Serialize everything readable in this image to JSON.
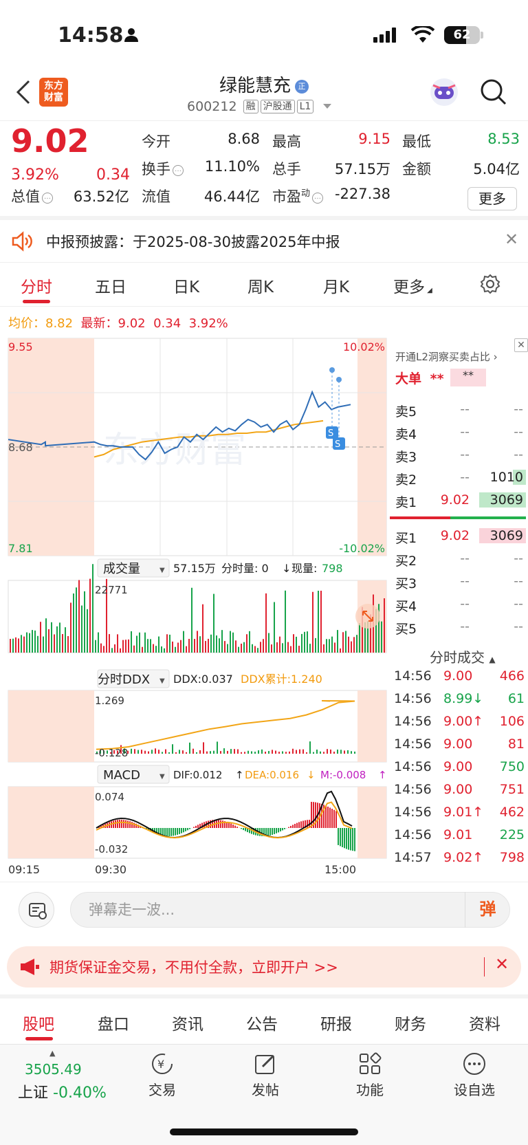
{
  "status_bar": {
    "time": "14:58",
    "battery": "62"
  },
  "header": {
    "title": "绿能慧充",
    "badge": "正",
    "code": "600212",
    "tags": [
      "融",
      "沪股通",
      "L1"
    ],
    "logo_line1": "东方",
    "logo_line2": "财富"
  },
  "quote": {
    "price": "9.02",
    "pct": "3.92%",
    "change": "0.34",
    "rows": [
      [
        {
          "label": "今开",
          "value": "8.68",
          "color": "normal"
        },
        {
          "label": "最高",
          "value": "9.15",
          "color": "red"
        },
        {
          "label": "最低",
          "value": "8.53",
          "color": "green"
        }
      ],
      [
        {
          "label": "换手",
          "value": "11.10%",
          "color": "normal"
        },
        {
          "label": "总手",
          "value": "57.15万",
          "color": "normal"
        },
        {
          "label": "金额",
          "value": "5.04亿",
          "color": "normal"
        }
      ]
    ],
    "total_value_label": "总值",
    "total_value": "63.52亿",
    "float_value_label": "流值",
    "float_value": "46.44亿",
    "pe_label": "市盈",
    "pe_sup": "动",
    "pe_value": "-227.38",
    "more": "更多"
  },
  "notice": {
    "text": "中报预披露：于2025-08-30披露2025年中报"
  },
  "chart_tabs": [
    {
      "label": "分时",
      "active": true
    },
    {
      "label": "五日"
    },
    {
      "label": "日K"
    },
    {
      "label": "周K"
    },
    {
      "label": "月K"
    },
    {
      "label": "更多"
    }
  ],
  "legend": {
    "avg_label": "均价：",
    "avg": "8.82",
    "latest_label": "最新：",
    "latest": "9.02",
    "chg": "0.34",
    "pct": "3.92%"
  },
  "chart_data": {
    "type": "line",
    "price_axis": {
      "top": "9.55",
      "mid": "8.68",
      "bottom": "7.81",
      "top_pct": "10.02%",
      "bottom_pct": "-10.02%"
    },
    "time_axis": [
      "09:15",
      "09:30",
      "15:00"
    ],
    "series": [],
    "volume": {
      "selector": "成交量",
      "total": "57.15万",
      "interval_label": "分时量: 0",
      "current_label": "现量:",
      "current": "798",
      "max_label": "22771"
    },
    "ddx": {
      "selector": "分时DDX",
      "ddx": "DDX:0.037",
      "cum": "DDX累计:1.240",
      "top": "1.269",
      "bottom": "-0.128"
    },
    "macd": {
      "selector": "MACD",
      "dif": "DIF:0.012",
      "dea": "DEA:0.016",
      "m": "M:-0.008",
      "top": "0.074",
      "bottom": "-0.032"
    },
    "price_points": [
      8.72,
      8.7,
      8.69,
      8.69,
      8.68,
      8.68,
      8.68,
      8.62,
      8.58,
      8.64,
      8.72,
      8.63,
      8.66,
      8.68,
      8.76,
      8.72,
      8.78,
      8.74,
      8.79,
      8.84,
      8.8,
      8.83,
      8.81,
      8.86,
      8.9,
      8.88,
      8.84,
      8.86,
      8.8,
      8.86,
      8.89,
      8.82,
      8.86,
      8.98,
      9.12,
      9.0,
      9.04,
      8.98,
      9.0,
      9.01,
      9.02
    ],
    "avg_points": [
      8.6,
      8.62,
      8.66,
      8.68,
      8.7,
      8.72,
      8.73,
      8.74,
      8.75,
      8.76,
      8.76,
      8.77,
      8.77,
      8.78,
      8.78,
      8.79,
      8.79,
      8.8,
      8.8,
      8.82,
      8.84,
      8.86,
      8.87,
      8.88,
      8.89
    ],
    "ddx_points": [
      -0.12,
      -0.1,
      -0.05,
      0.05,
      0.15,
      0.25,
      0.35,
      0.45,
      0.52,
      0.6,
      0.65,
      0.7,
      0.75,
      0.85,
      1.0,
      1.2,
      1.24
    ]
  },
  "order_book": {
    "l2_text": "开通L2洞察买卖占比",
    "dadan": "大单",
    "dadan_v1": "**",
    "dadan_v2": "**",
    "asks": [
      {
        "label": "卖5",
        "price": "--",
        "vol": "--"
      },
      {
        "label": "卖4",
        "price": "--",
        "vol": "--"
      },
      {
        "label": "卖3",
        "price": "--",
        "vol": "--"
      },
      {
        "label": "卖2",
        "price": "--",
        "vol": "1010"
      },
      {
        "label": "卖1",
        "price": "9.02",
        "vol": "3069"
      }
    ],
    "bids": [
      {
        "label": "买1",
        "price": "9.02",
        "vol": "3069"
      },
      {
        "label": "买2",
        "price": "--",
        "vol": "--"
      },
      {
        "label": "买3",
        "price": "--",
        "vol": "--"
      },
      {
        "label": "买4",
        "price": "--",
        "vol": "--"
      },
      {
        "label": "买5",
        "price": "--",
        "vol": "--"
      }
    ],
    "trades_title": "分时成交",
    "trades": [
      {
        "time": "14:56",
        "price": "9.00",
        "vol": "466",
        "dir": "",
        "color": "red"
      },
      {
        "time": "14:56",
        "price": "8.99",
        "vol": "61",
        "dir": "↓",
        "color": "green"
      },
      {
        "time": "14:56",
        "price": "9.00",
        "vol": "106",
        "dir": "↑",
        "color": "red"
      },
      {
        "time": "14:56",
        "price": "9.00",
        "vol": "81",
        "dir": "",
        "color": "red"
      },
      {
        "time": "14:56",
        "price": "9.00",
        "vol": "750",
        "dir": "",
        "color": "green"
      },
      {
        "time": "14:56",
        "price": "9.00",
        "vol": "751",
        "dir": "",
        "color": "red"
      },
      {
        "time": "14:56",
        "price": "9.01",
        "vol": "462",
        "dir": "↑",
        "color": "red"
      },
      {
        "time": "14:56",
        "price": "9.01",
        "vol": "225",
        "dir": "",
        "color": "green"
      },
      {
        "time": "14:57",
        "price": "9.02",
        "vol": "798",
        "dir": "↑",
        "color": "red"
      }
    ]
  },
  "danmu": {
    "placeholder": "弹幕走一波...",
    "btn": "弹"
  },
  "ad": {
    "text": "期货保证金交易，不用付全款，立即开户 >>"
  },
  "bottom_tabs": [
    {
      "label": "股吧",
      "active": true
    },
    {
      "label": "盘口"
    },
    {
      "label": "资讯"
    },
    {
      "label": "公告"
    },
    {
      "label": "研报"
    },
    {
      "label": "财务"
    },
    {
      "label": "资料"
    }
  ],
  "bottom_bar": {
    "index_value": "3505.49",
    "index_name": "上证",
    "index_pct": "-0.40%",
    "items": [
      "交易",
      "发帖",
      "功能",
      "设自选"
    ]
  },
  "colors": {
    "red": "#e0212f",
    "green": "#17a34a",
    "orange": "#f29b0f",
    "accent": "#ee5b1f",
    "line_blue": "#2f6db6"
  }
}
